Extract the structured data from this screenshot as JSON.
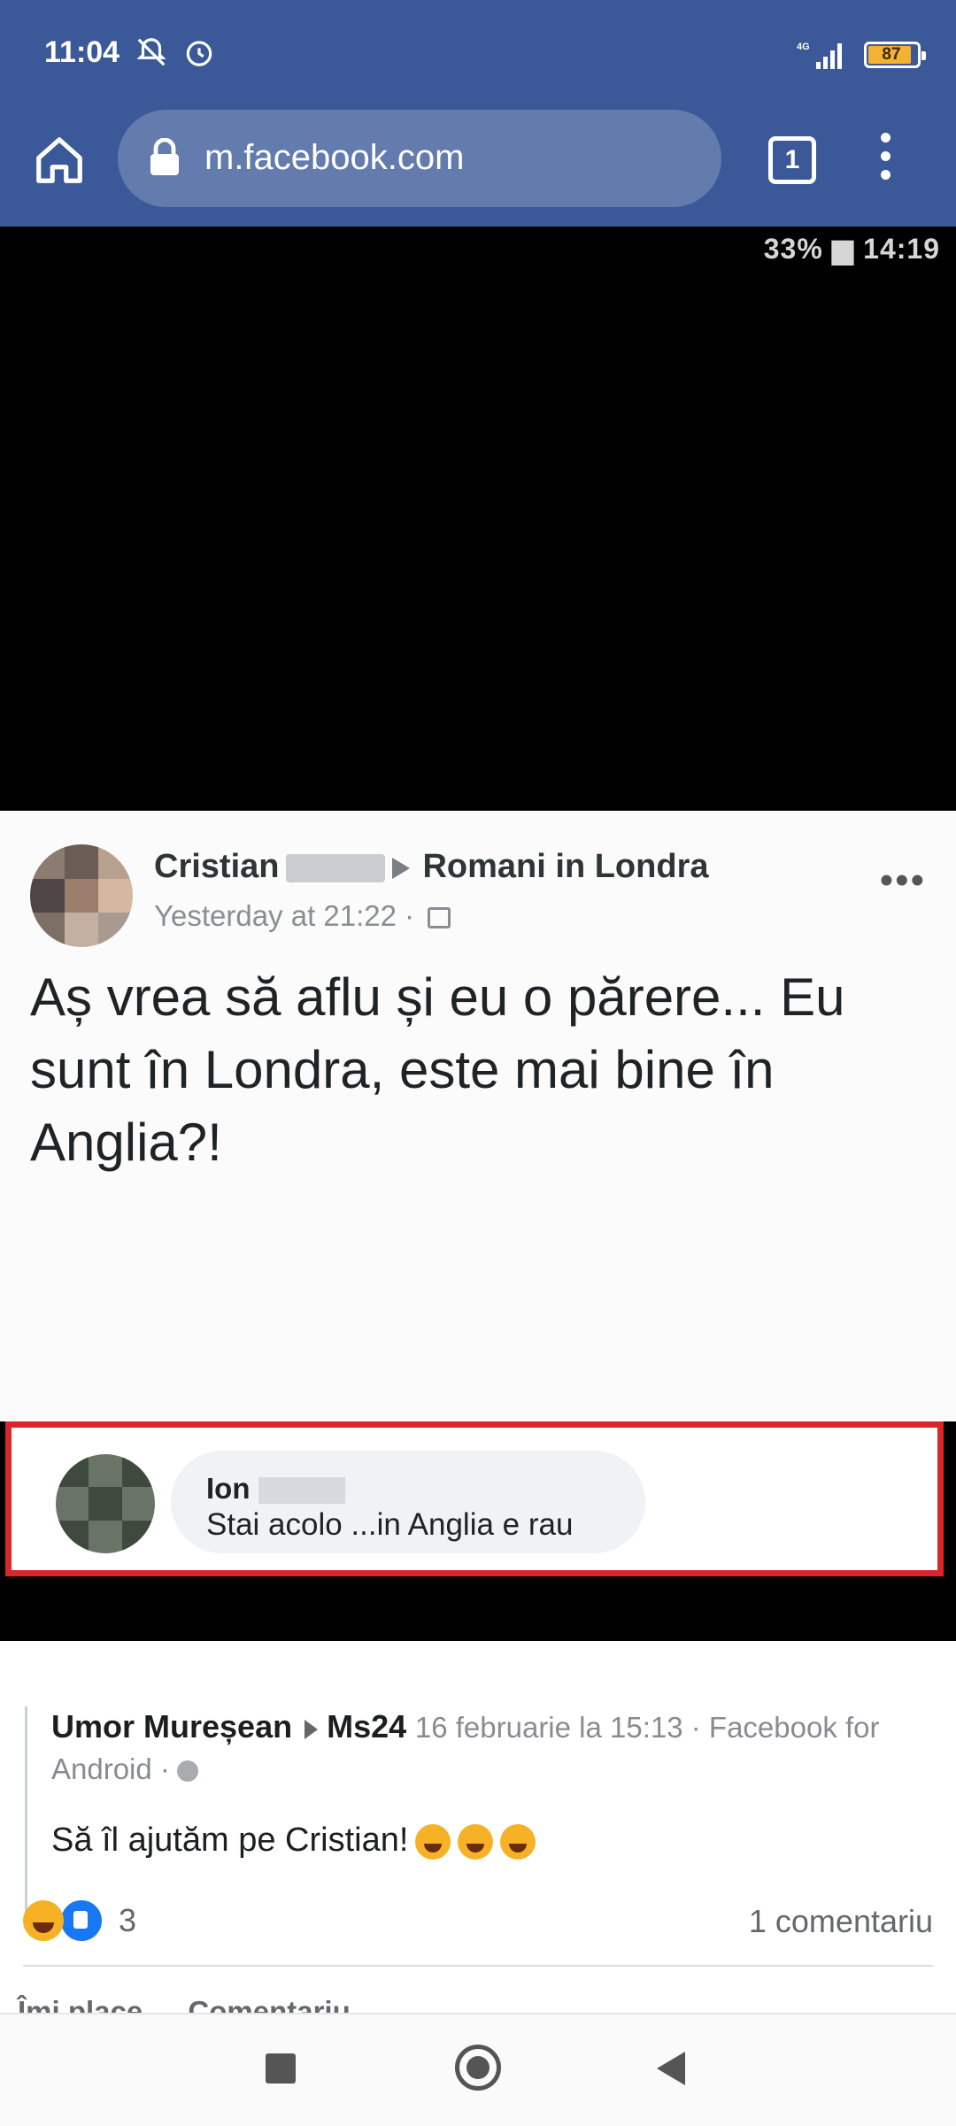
{
  "status_bar": {
    "time": "11:04",
    "network": "4G",
    "battery": "87"
  },
  "browser": {
    "url": "m.facebook.com",
    "tab_count": "1"
  },
  "screenshot_image": {
    "inner_status": "33% ▆ 14:19",
    "post": {
      "author": "Cristian",
      "group": "Romani in Londra",
      "time": "Yesterday at 21:22 ·",
      "text": "Aș vrea să aflu și eu o părere... Eu sunt în Londra, este mai bine în Anglia?!"
    },
    "comment": {
      "author": "Ion",
      "text": "Stai acolo ...in Anglia e rau"
    }
  },
  "fb_post": {
    "author": "Umor Mureșean",
    "target": "Ms24",
    "meta": "16 februarie la 15:13 · Facebook for",
    "meta2": "Android ·",
    "caption": "Să îl ajutăm pe Cristian!",
    "reaction_count": "3",
    "comments_count": "1 comentariu",
    "actions": [
      "Îmi place",
      "Comentariu"
    ]
  },
  "colors": {
    "facebook_blue": "#3b5998",
    "highlight_red": "#d8262a"
  }
}
